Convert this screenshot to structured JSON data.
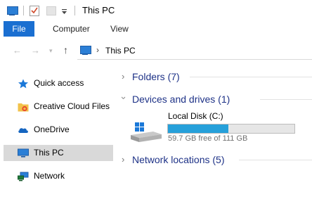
{
  "window": {
    "title": "This PC"
  },
  "ribbon": {
    "tabs": [
      "File",
      "Computer",
      "View"
    ]
  },
  "address_bar": {
    "location": "This PC"
  },
  "sidebar": {
    "items": [
      {
        "label": "Quick access",
        "icon": "star-icon"
      },
      {
        "label": "Creative Cloud Files",
        "icon": "creative-cloud-folder-icon"
      },
      {
        "label": "OneDrive",
        "icon": "cloud-icon"
      },
      {
        "label": "This PC",
        "icon": "computer-icon",
        "selected": true
      },
      {
        "label": "Network",
        "icon": "network-icon"
      }
    ]
  },
  "content": {
    "groups": [
      {
        "label": "Folders (7)",
        "expanded": false
      },
      {
        "label": "Devices and drives (1)",
        "expanded": true
      },
      {
        "label": "Network locations (5)",
        "expanded": false
      }
    ],
    "drive": {
      "name": "Local Disk (C:)",
      "free_text": "59.7 GB free of 111 GB",
      "used_fraction": 0.48
    }
  },
  "colors": {
    "accent": "#1a6fd1",
    "group_label": "#1e3287",
    "usage_bar": "#26a0da",
    "selection": "#d9d9d9"
  }
}
